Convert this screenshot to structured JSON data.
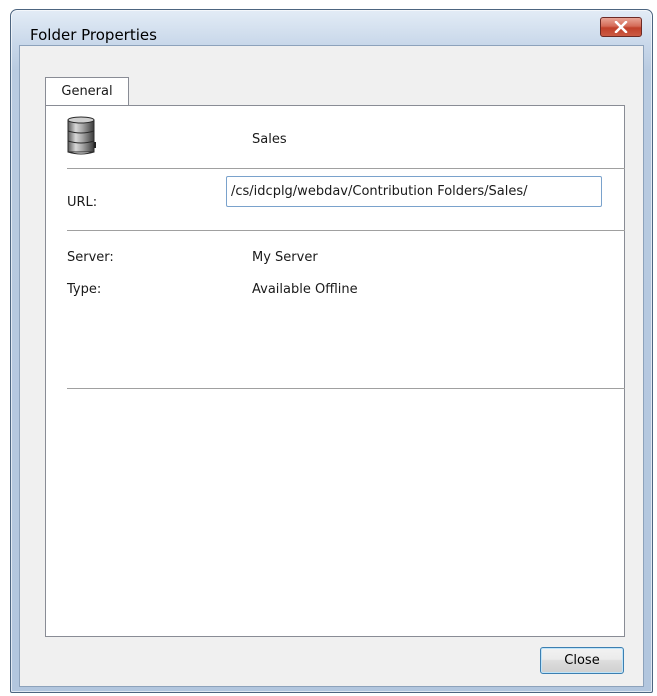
{
  "window": {
    "title": "Folder Properties",
    "close_icon": "close-icon"
  },
  "tabs": [
    {
      "label": "General",
      "active": true
    }
  ],
  "general": {
    "folder_icon": "database-icon",
    "folder_name": "Sales",
    "url_label": "URL:",
    "url_value": "/cs/idcplg/webdav/Contribution Folders/Sales/",
    "server_label": "Server:",
    "server_value": "My Server",
    "type_label": "Type:",
    "type_value": "Available Offline"
  },
  "footer": {
    "close_label": "Close"
  }
}
